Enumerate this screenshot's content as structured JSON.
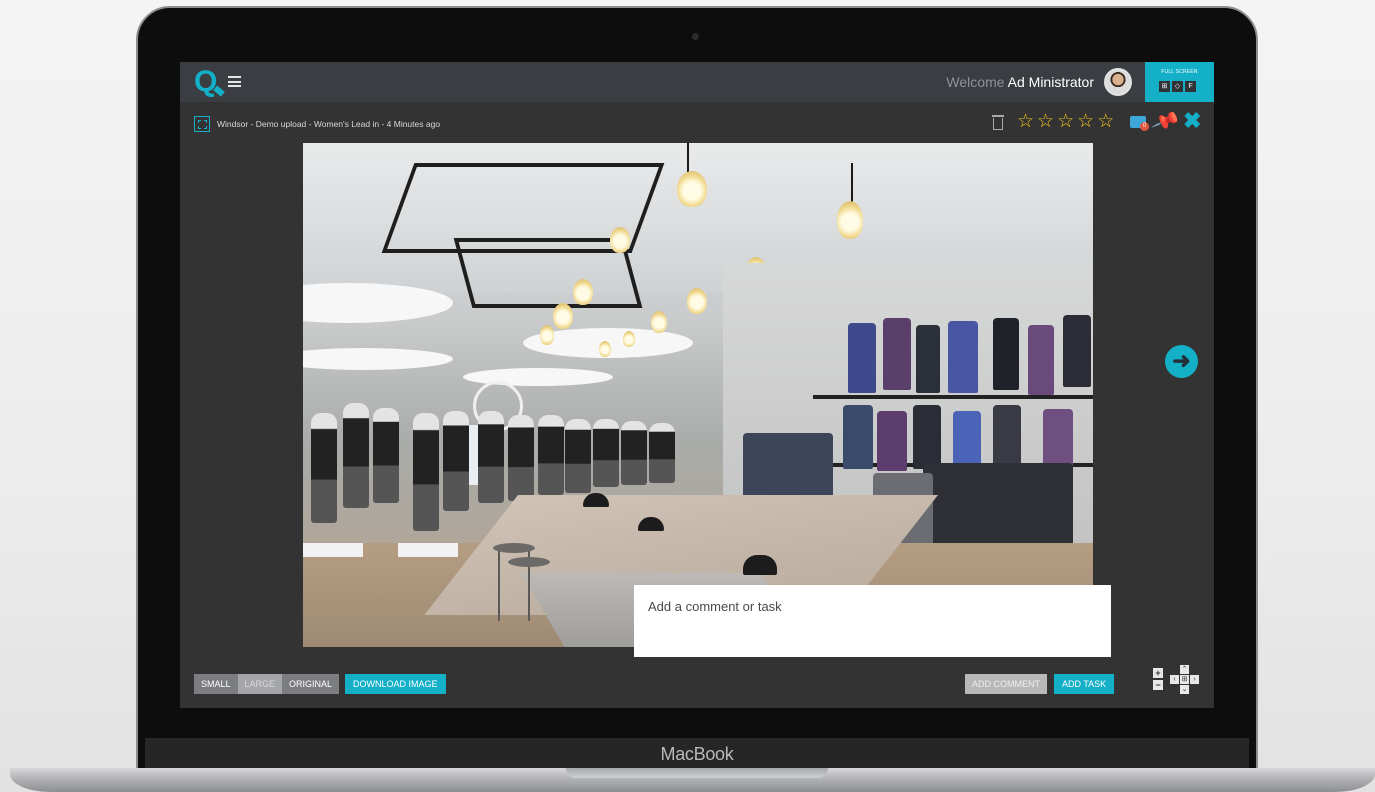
{
  "device": {
    "brand": "MacBook"
  },
  "header": {
    "logo": "Q",
    "welcome_prefix": "Welcome",
    "user_name": "Ad Ministrator",
    "fullscreen_label": "FULL SCREEN",
    "fullscreen_buttons": [
      "⊞",
      "◇",
      "F"
    ]
  },
  "toolbar": {
    "breadcrumb": "Windsor - Demo upload - Women's Lead in - 4 Minutes ago",
    "rating": {
      "value": 0,
      "max": 5
    },
    "star_glyph": "☆",
    "comment_count": "0",
    "close_glyph": "✖",
    "pin_glyph": "📌"
  },
  "viewer": {
    "comment_placeholder": "Add a comment or task",
    "next_glyph": "➜"
  },
  "bottom": {
    "size_options": [
      "SMALL",
      "LARGE",
      "ORIGINAL"
    ],
    "selected_size": "LARGE",
    "download_label": "DOWNLOAD IMAGE",
    "add_comment_label": "ADD COMMENT",
    "add_task_label": "ADD TASK",
    "zoom": {
      "in": "+",
      "out": "−"
    },
    "pan": {
      "up": "⌃",
      "down": "⌄",
      "left": "‹",
      "right": "›",
      "center": "⊞"
    }
  },
  "colors": {
    "accent": "#13b0c8",
    "screen_bg": "#333333",
    "topbar_bg": "#3a3d42",
    "star": "#f3c51a"
  }
}
